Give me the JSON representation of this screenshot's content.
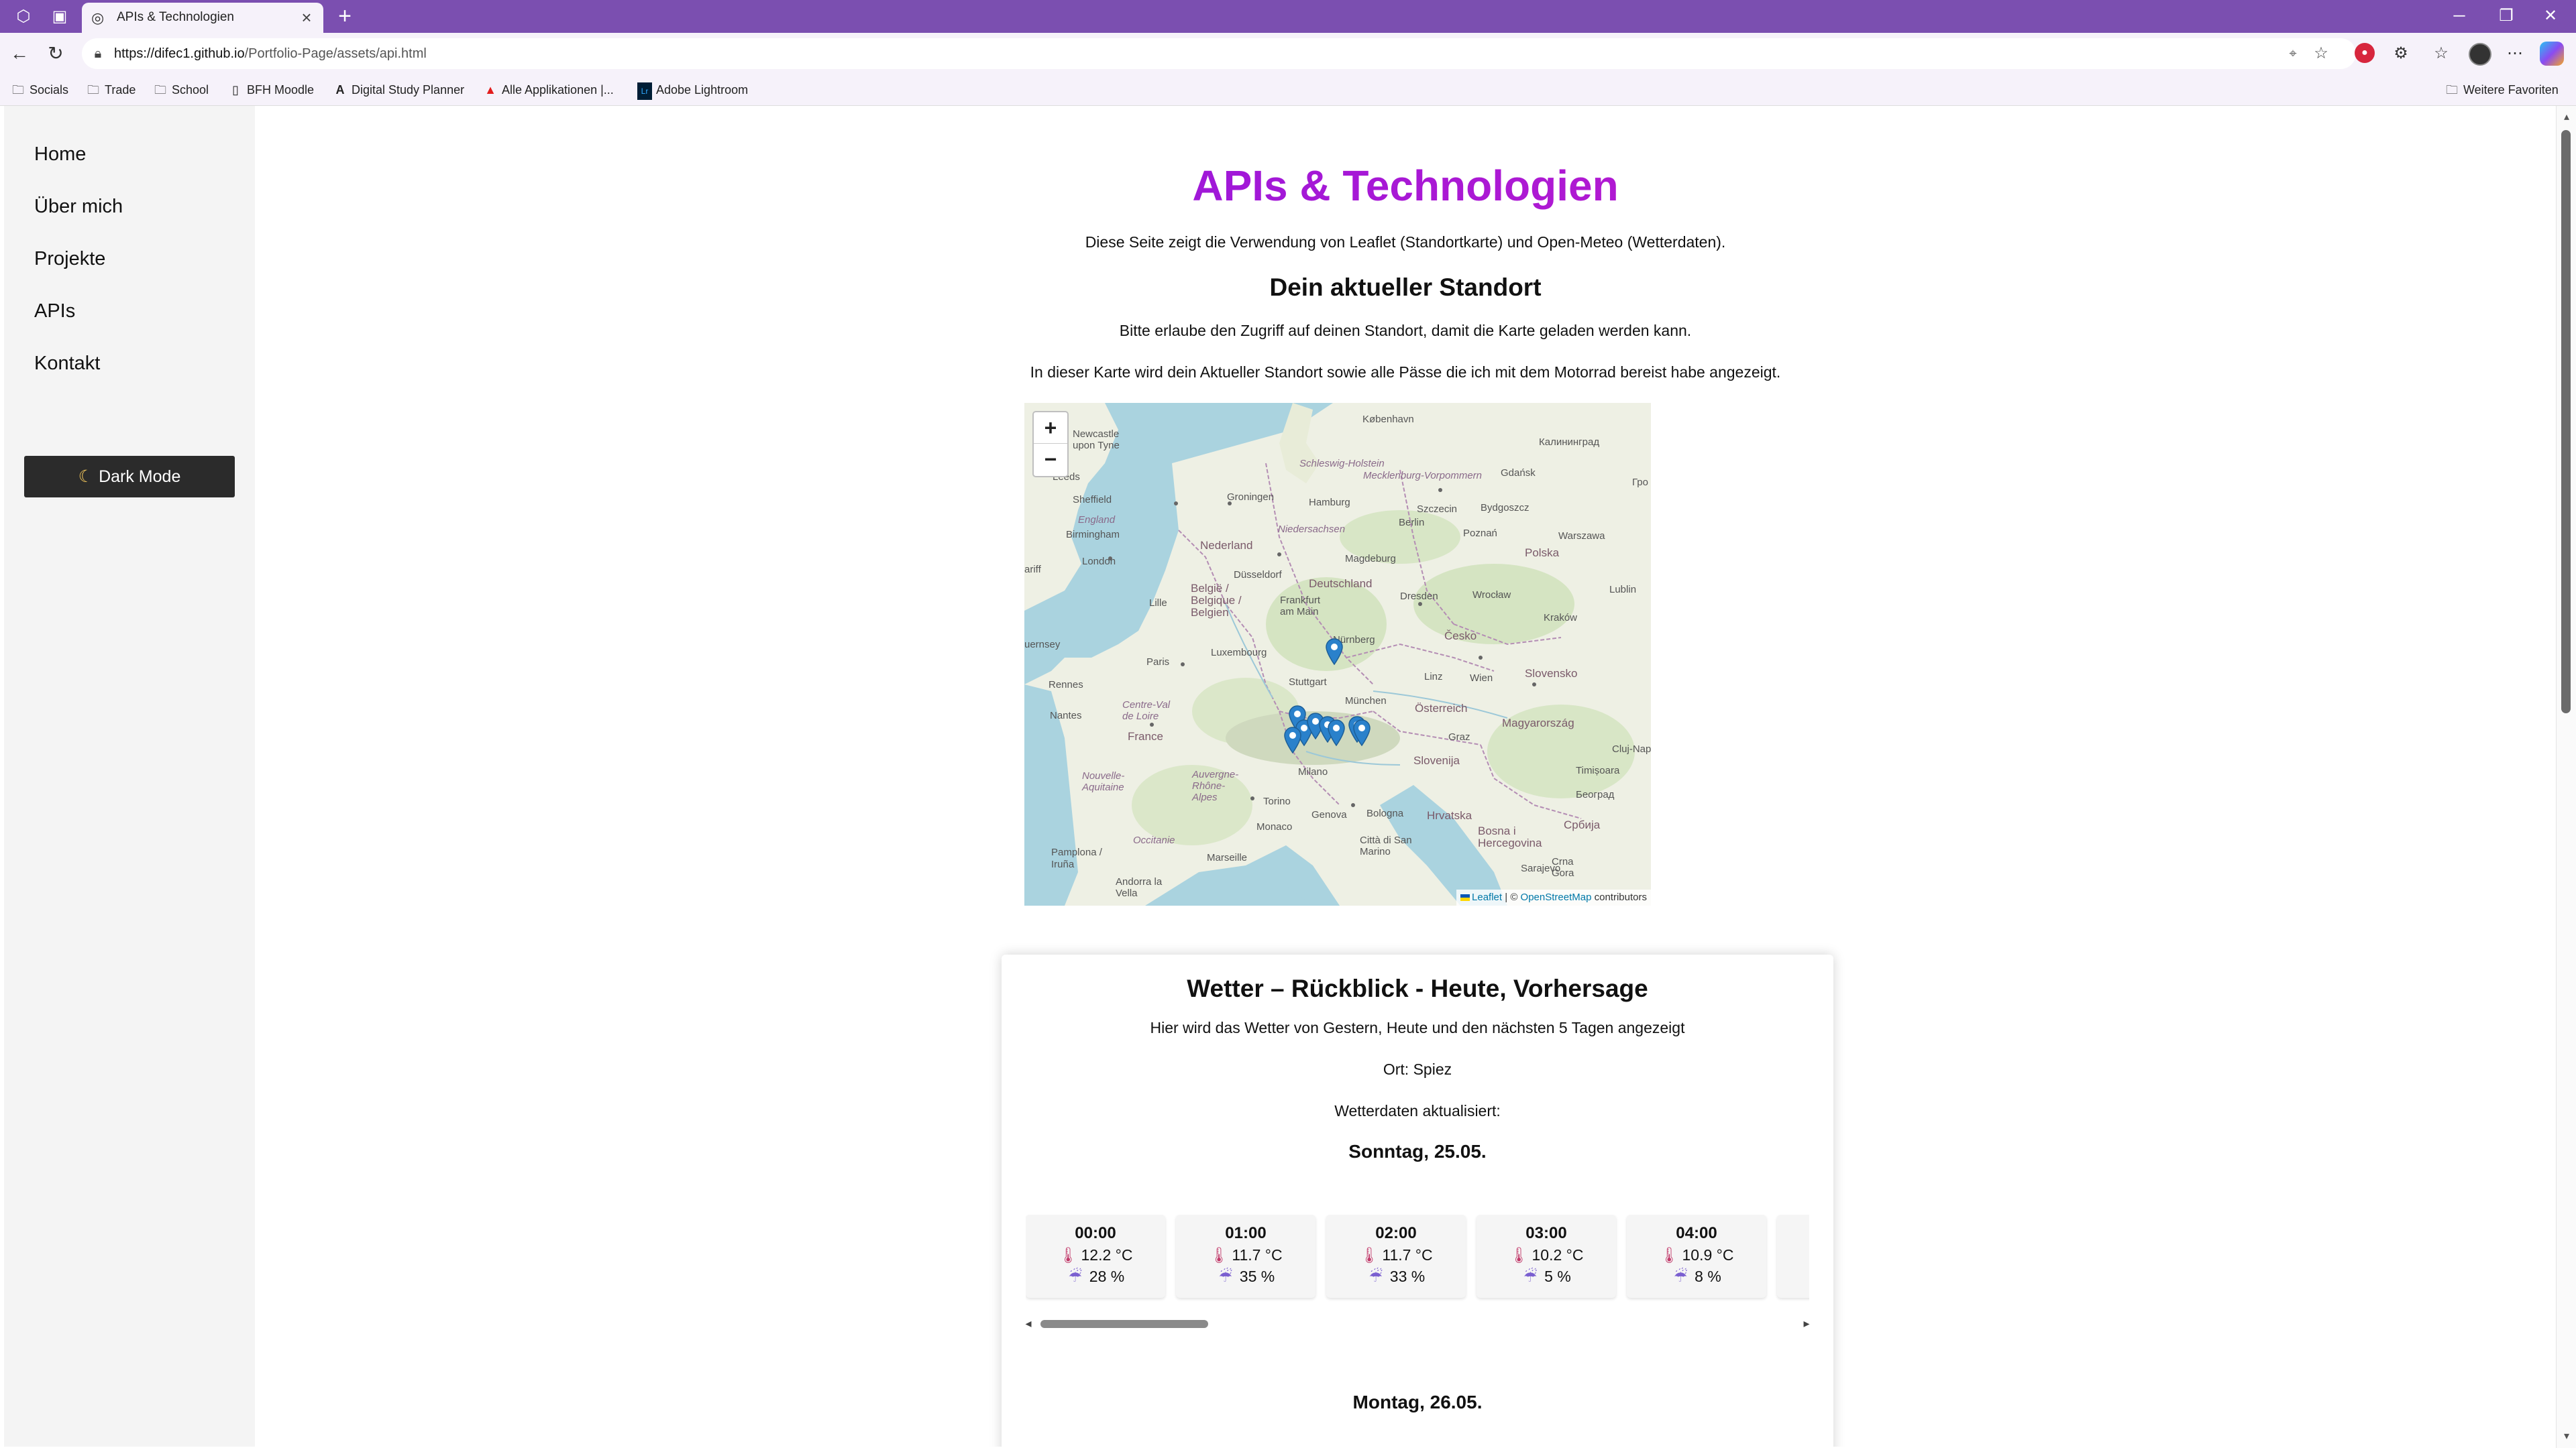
{
  "browser": {
    "tab_title": "APIs & Technologien",
    "url_host": "https://difec1.github.io",
    "url_path": "/Portfolio-Page/assets/api.html",
    "bookmarks": [
      {
        "label": "Socials",
        "icon": "folder-icon"
      },
      {
        "label": "Trade",
        "icon": "folder-icon"
      },
      {
        "label": "School",
        "icon": "folder-icon"
      },
      {
        "label": "BFH Moodle",
        "icon": "page-icon"
      },
      {
        "label": "Digital Study Planner",
        "icon": "logo-a-icon"
      },
      {
        "label": "Alle Applikationen |...",
        "icon": "adobe-icon"
      },
      {
        "label": "Adobe Lightroom",
        "icon": "lightroom-icon"
      }
    ],
    "other_favorites": "Weitere Favoriten",
    "accent_color": "#7b4fb0"
  },
  "sidebar": {
    "items": [
      {
        "label": "Home"
      },
      {
        "label": "Über mich"
      },
      {
        "label": "Projekte"
      },
      {
        "label": "APIs"
      },
      {
        "label": "Kontakt"
      }
    ],
    "dark_mode_label": "Dark Mode"
  },
  "main": {
    "title": "APIs & Technologien",
    "intro": "Diese Seite zeigt die Verwendung von Leaflet (Standortkarte) und Open-Meteo (Wetterdaten).",
    "location_heading": "Dein aktueller Standort",
    "location_permission": "Bitte erlaube den Zugriff auf deinen Standort, damit die Karte geladen werden kann.",
    "location_desc": "In dieser Karte wird dein Aktueller Standort sowie alle Pässe die ich mit dem Motorrad bereist habe angezeigt."
  },
  "map": {
    "zoom_in": "+",
    "zoom_out": "−",
    "attribution_leaflet": "Leaflet",
    "attribution_sep": "| ©",
    "attribution_osm": "OpenStreetMap",
    "attribution_rest": "contributors",
    "labels": {
      "kobenhavn": "København",
      "kaliningrad": "Калининград",
      "newcastle": "Newcastle upon Tyne",
      "leeds": "Leeds",
      "sheffield": "Sheffield",
      "england": "England",
      "birmingham": "Birmingham",
      "london": "London",
      "groningen": "Groningen",
      "hamburg": "Hamburg",
      "schleswig": "Schleswig-Holstein",
      "mecklenburg": "Mecklenburg-Vorpommern",
      "gdansk": "Gdańsk",
      "szczecin": "Szczecin",
      "bydgoszcz": "Bydgoszcz",
      "nederland": "Nederland",
      "niedersachsen": "Niedersachsen",
      "berlin": "Berlin",
      "poznan": "Poznań",
      "polska": "Polska",
      "warszawa": "Warszawa",
      "magdeburg": "Magdeburg",
      "dusseldorf": "Düsseldorf",
      "deutschland": "Deutschland",
      "lublin": "Lublin",
      "belgie": "België / Belgique / Belgien",
      "frankfurt": "Frankfurt am Main",
      "dresden": "Dresden",
      "wroclaw": "Wrocław",
      "krakow": "Kraków",
      "lille": "Lille",
      "cesko": "Česko",
      "luxembourg": "Luxembourg",
      "nurnberg": "Nürnberg",
      "paris": "Paris",
      "stuttgart": "Stuttgart",
      "slovensko": "Slovensko",
      "linz": "Linz",
      "wien": "Wien",
      "rennes": "Rennes",
      "munchen": "München",
      "osterreich": "Österreich",
      "magyarorszag": "Magyarország",
      "nantes": "Nantes",
      "centre": "Centre-Val de Loire",
      "france": "France",
      "graz": "Graz",
      "cluj": "Cluj-Napoca",
      "slovenija": "Slovenija",
      "timisoara": "Timișoara",
      "aquitaine": "Nouvelle-Aquitaine",
      "auvergne": "Auvergne-Rhône-Alpes",
      "milano": "Milano",
      "beograd": "Београд",
      "torino": "Torino",
      "genova": "Genova",
      "bologna": "Bologna",
      "hrvatska": "Hrvatska",
      "bih": "Bosna i Hercegovina",
      "srbija": "Србија",
      "occitanie": "Occitanie",
      "monaco": "Monaco",
      "sarajevo": "Sarajevo",
      "citta": "Città di San Marino",
      "pamplona": "Pamplona / Iruña",
      "marseille": "Marseille",
      "crnagora": "Crna Gora",
      "andorra": "Andorra la Vella",
      "gpo": "Гро",
      "suess": "uernsey",
      "arif": "ariff"
    },
    "markers": [
      {
        "lat": 48.8,
        "lon": 9.2
      },
      {
        "lat": 46.9,
        "lon": 7.6
      },
      {
        "lat": 46.5,
        "lon": 7.9
      },
      {
        "lat": 46.7,
        "lon": 8.4
      },
      {
        "lat": 46.6,
        "lon": 8.9
      },
      {
        "lat": 46.5,
        "lon": 9.3
      },
      {
        "lat": 46.6,
        "lon": 10.2
      },
      {
        "lat": 46.5,
        "lon": 10.4
      },
      {
        "lat": 46.3,
        "lon": 7.4
      }
    ]
  },
  "weather": {
    "title": "Wetter – Rückblick - Heute, Vorhersage",
    "desc": "Hier wird das Wetter von Gestern, Heute und den nächsten 5 Tagen angezeigt",
    "location": "Ort: Spiez",
    "updated": "Wetterdaten aktualisiert:",
    "day1": "Sonntag, 25.05.",
    "day2": "Montag, 26.05.",
    "hours": [
      {
        "time": "00:00",
        "temp": "12.2 °C",
        "rain": "28 %"
      },
      {
        "time": "01:00",
        "temp": "11.7 °C",
        "rain": "35 %"
      },
      {
        "time": "02:00",
        "temp": "11.7 °C",
        "rain": "33 %"
      },
      {
        "time": "03:00",
        "temp": "10.2 °C",
        "rain": "5 %"
      },
      {
        "time": "04:00",
        "temp": "10.9 °C",
        "rain": "8 %"
      }
    ]
  }
}
